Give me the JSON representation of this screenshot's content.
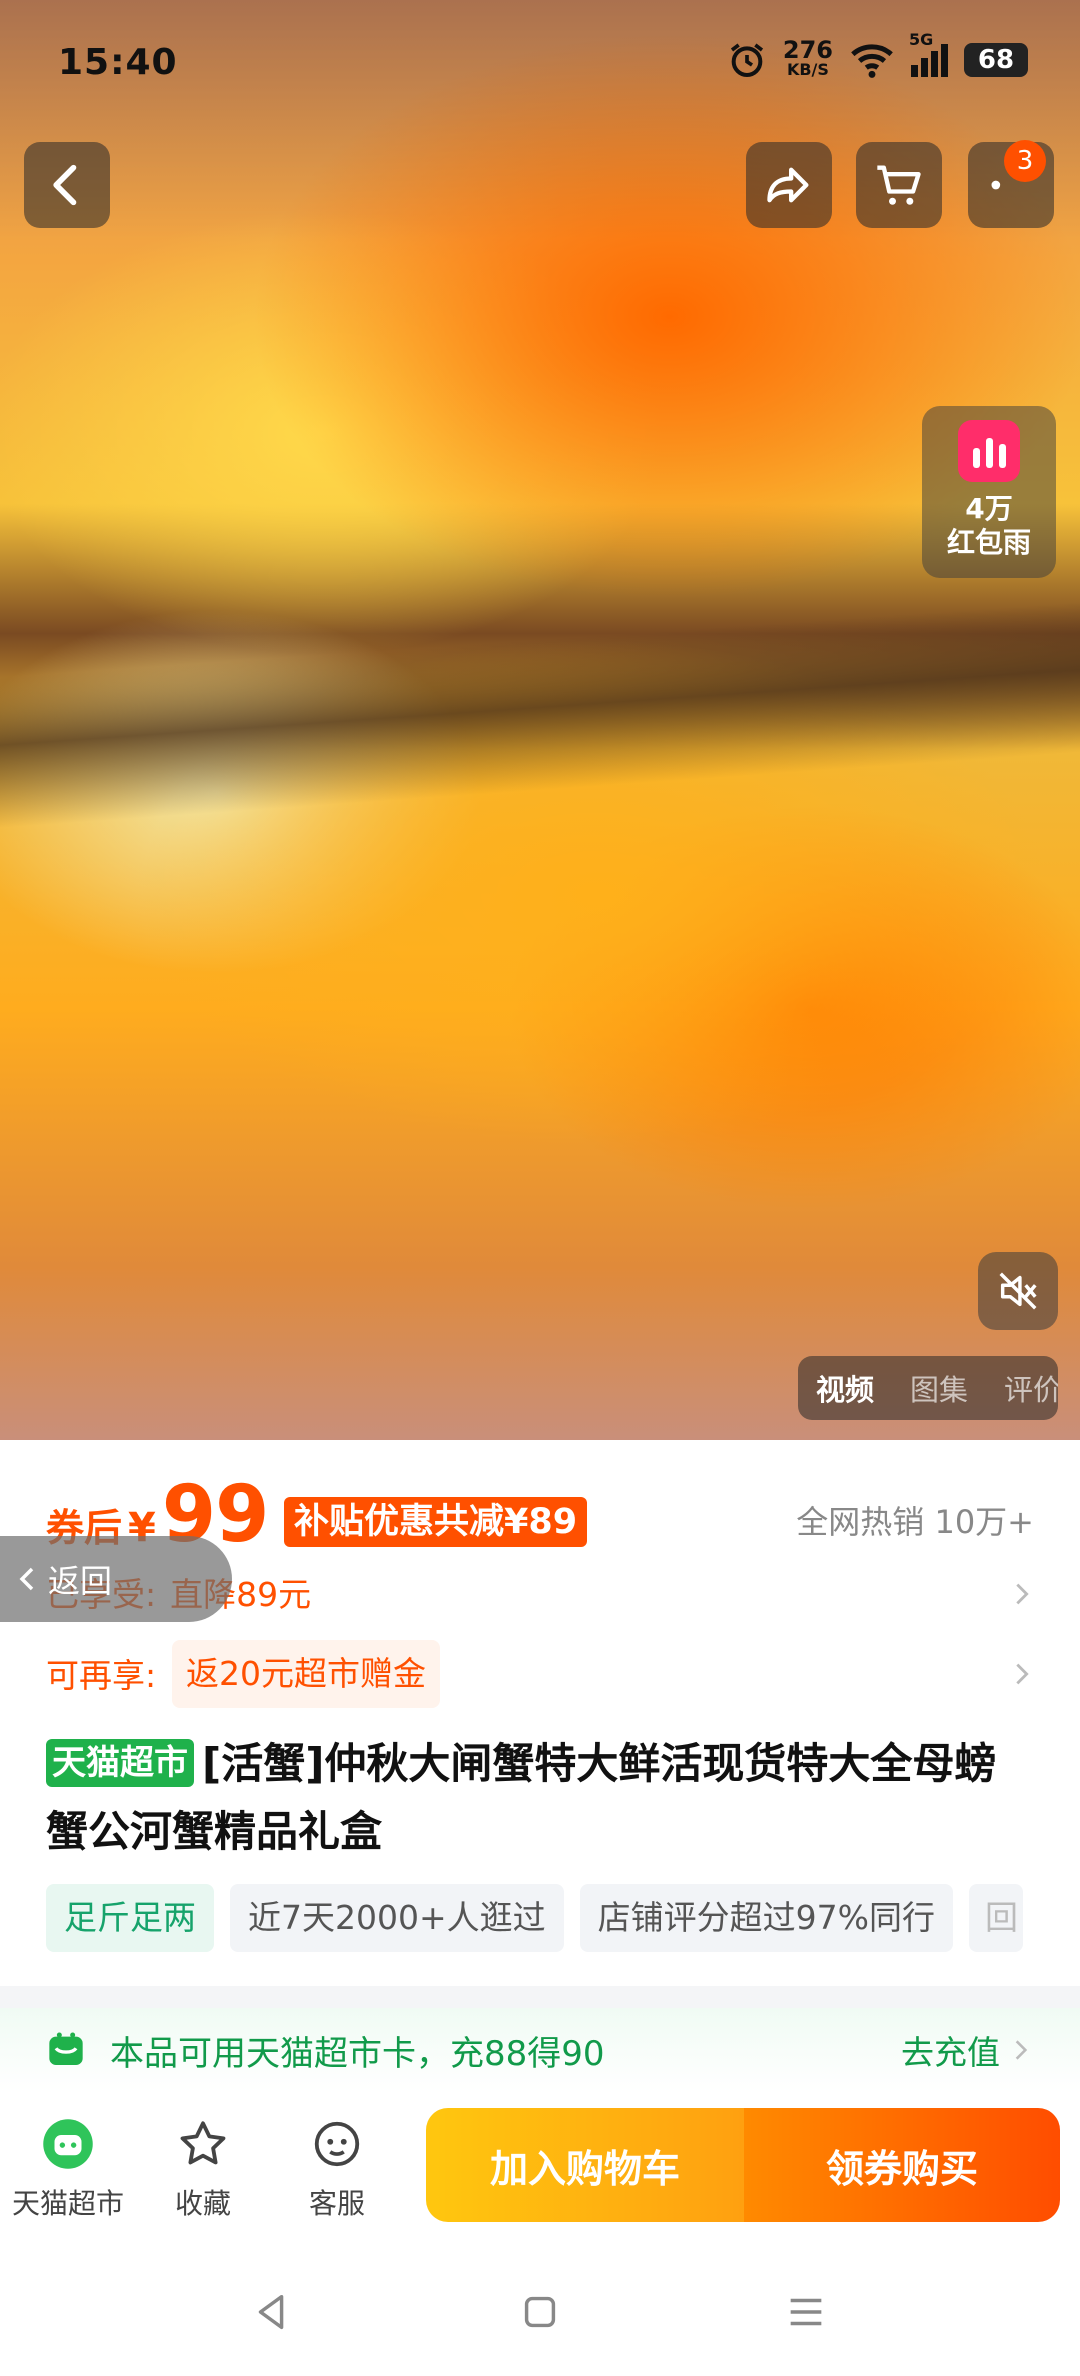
{
  "status_bar": {
    "time": "15:40",
    "net_speed_value": "276",
    "net_speed_unit": "KB/S",
    "network": "5G",
    "battery": "68"
  },
  "top_nav": {
    "cart_badge": "3"
  },
  "promo": {
    "line1": "4万",
    "line2": "红包雨"
  },
  "media_tabs": [
    "视频",
    "图集",
    "评价"
  ],
  "price": {
    "label": "券后",
    "currency": "¥",
    "amount": "99",
    "subsidy": "补贴优惠共减¥89",
    "hot_sales": "全网热销 10万+"
  },
  "back_pill": "返回",
  "discount_rows": [
    {
      "key": "已享受:",
      "value": "直降89元"
    },
    {
      "key": "可再享:",
      "value": "返20元超市赠金"
    }
  ],
  "product": {
    "store_tag": "天猫超市",
    "title": "[活蟹]仲秋大闸蟹特大鲜活现货特大全母螃蟹公河蟹精品礼盒"
  },
  "chips": [
    "足斤足两",
    "近7天2000+人逛过",
    "店铺评分超过97%同行",
    "回"
  ],
  "membership_card": {
    "text": "本品可用天猫超市卡，充88得90",
    "action": "去充值"
  },
  "action_bar": {
    "store": "天猫超市",
    "favorite": "收藏",
    "service": "客服",
    "add_to_cart": "加入购物车",
    "buy": "领券购买"
  },
  "colors": {
    "accent_orange": "#ff5000",
    "tmall_green": "#1fb14b",
    "cart_yellow": "#ffb20f",
    "buy_orange": "#ff5a00"
  },
  "icons": [
    "back-icon",
    "share-icon",
    "cart-icon",
    "more-icon",
    "red-envelope-rain-icon",
    "mute-icon",
    "chevron-right-icon",
    "card-icon",
    "tmall-store-icon",
    "star-icon",
    "customer-service-icon",
    "nav-back-icon",
    "nav-home-icon",
    "nav-menu-icon"
  ]
}
